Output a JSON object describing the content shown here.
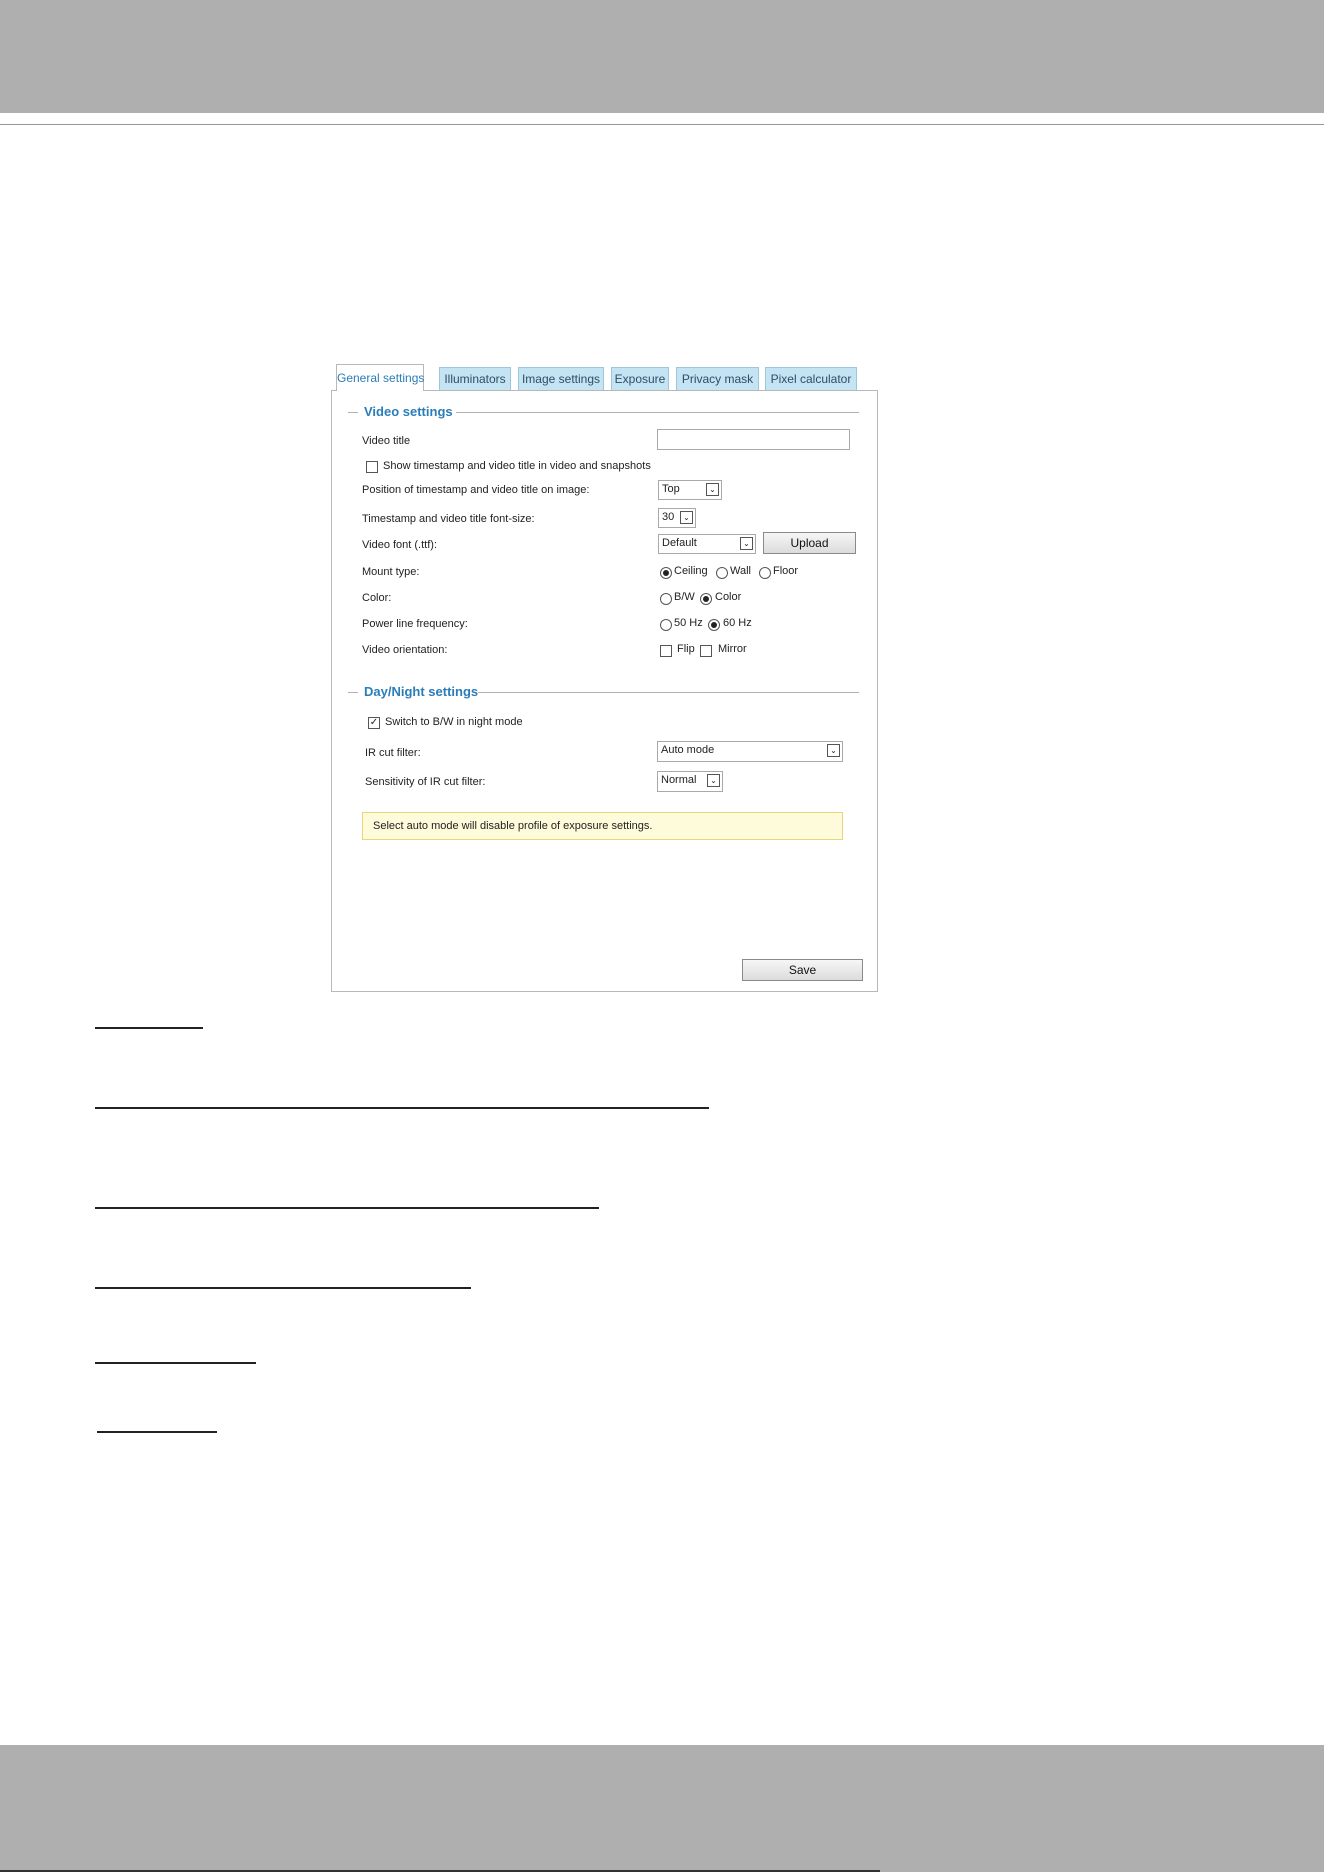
{
  "tabs": [
    {
      "label": "General settings"
    },
    {
      "label": "Illuminators"
    },
    {
      "label": "Image settings"
    },
    {
      "label": "Exposure"
    },
    {
      "label": "Privacy mask"
    },
    {
      "label": "Pixel calculator"
    }
  ],
  "video_settings": {
    "legend": "Video settings",
    "video_title_label": "Video title",
    "video_title_value": "",
    "show_timestamp_label": "Show timestamp and video title in video and snapshots",
    "show_timestamp_checked": false,
    "position_label": "Position of timestamp and video title on image:",
    "position_value": "Top",
    "font_size_label": "Timestamp and video title font-size:",
    "font_size_value": "30",
    "video_font_label": "Video font (.ttf):",
    "video_font_value": "Default",
    "upload_label": "Upload",
    "mount_type_label": "Mount type:",
    "mount_options": [
      "Ceiling",
      "Wall",
      "Floor"
    ],
    "mount_selected": "Ceiling",
    "color_label": "Color:",
    "color_options": [
      "B/W",
      "Color"
    ],
    "color_selected": "Color",
    "power_line_label": "Power line frequency:",
    "power_line_options": [
      "50 Hz",
      "60 Hz"
    ],
    "power_line_selected": "60 Hz",
    "orientation_label": "Video orientation:",
    "flip_label": "Flip",
    "mirror_label": "Mirror"
  },
  "day_night": {
    "legend": "Day/Night settings",
    "switch_bw_label": "Switch to B/W in night mode",
    "switch_bw_checked": true,
    "ir_cut_label": "IR cut filter:",
    "ir_cut_value": "Auto mode",
    "sensitivity_label": "Sensitivity of IR cut filter:",
    "sensitivity_value": "Normal",
    "note": "Select auto mode will disable profile of exposure settings."
  },
  "save_label": "Save",
  "icons": {
    "dropdown": "chevron-down-icon",
    "check": "check-icon"
  }
}
